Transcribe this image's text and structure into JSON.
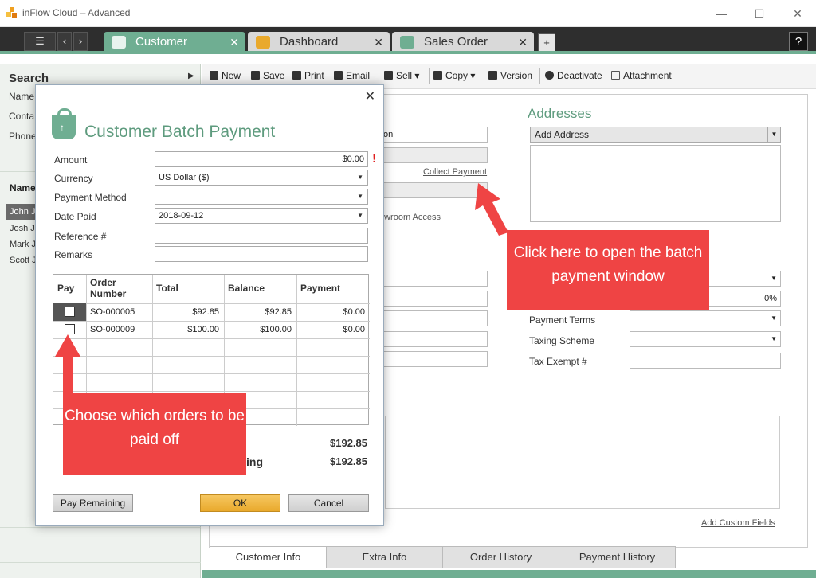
{
  "window": {
    "title": "inFlow Cloud – Advanced"
  },
  "tabs": [
    {
      "label": "Customer"
    },
    {
      "label": "Dashboard"
    },
    {
      "label": "Sales Order"
    }
  ],
  "help_label": "?",
  "sidebar": {
    "search_title": "Search",
    "fields": [
      "Name",
      "Conta",
      "Phone"
    ],
    "list_header": "Name",
    "items": [
      "John J",
      "Josh Jo",
      "Mark J",
      "Scott J"
    ]
  },
  "toolbar": {
    "new": "New",
    "save": "Save",
    "print": "Print",
    "email": "Email",
    "sell": "Sell",
    "copy": "Copy",
    "version": "Version",
    "deactivate": "Deactivate",
    "attachment": "Attachment"
  },
  "customer": {
    "name_partial": "on",
    "collect_payment": "Collect Payment",
    "showroom_access": "owroom Access",
    "discount": "0%",
    "addresses_title": "Addresses",
    "add_address": "Add Address",
    "payment_terms_label": "Payment Terms",
    "taxing_scheme_label": "Taxing Scheme",
    "tax_exempt_label": "Tax Exempt #",
    "add_custom_fields": "Add Custom Fields"
  },
  "bottom_tabs": [
    "Customer Info",
    "Extra Info",
    "Order History",
    "Payment History"
  ],
  "dialog": {
    "title": "Customer Batch Payment",
    "amount_label": "Amount",
    "amount_value": "$0.00",
    "required_mark": "!",
    "currency_label": "Currency",
    "currency_value": "US Dollar ($)",
    "payment_method_label": "Payment Method",
    "payment_method_value": "",
    "date_paid_label": "Date Paid",
    "date_paid_value": "2018-09-12",
    "reference_label": "Reference #",
    "reference_value": "",
    "remarks_label": "Remarks",
    "remarks_value": "",
    "grid": {
      "headers": {
        "pay": "Pay",
        "order_number": "Order Number",
        "total": "Total",
        "balance": "Balance",
        "payment": "Payment"
      },
      "rows": [
        {
          "order_number": "SO-000005",
          "total": "$92.85",
          "balance": "$92.85",
          "payment": "$0.00"
        },
        {
          "order_number": "SO-000009",
          "total": "$100.00",
          "balance": "$100.00",
          "payment": "$0.00"
        }
      ]
    },
    "sum_total": "$192.85",
    "remaining_label_partial": "ing",
    "remaining_value": "$192.85",
    "pay_remaining": "Pay Remaining",
    "ok": "OK",
    "cancel": "Cancel"
  },
  "callouts": {
    "collect": "Click here to open the batch payment window",
    "orders": "Choose which orders to be paid off"
  },
  "colors": {
    "accent": "#6fae92",
    "callout": "#ef4444",
    "ok_button": "#f0b444"
  }
}
